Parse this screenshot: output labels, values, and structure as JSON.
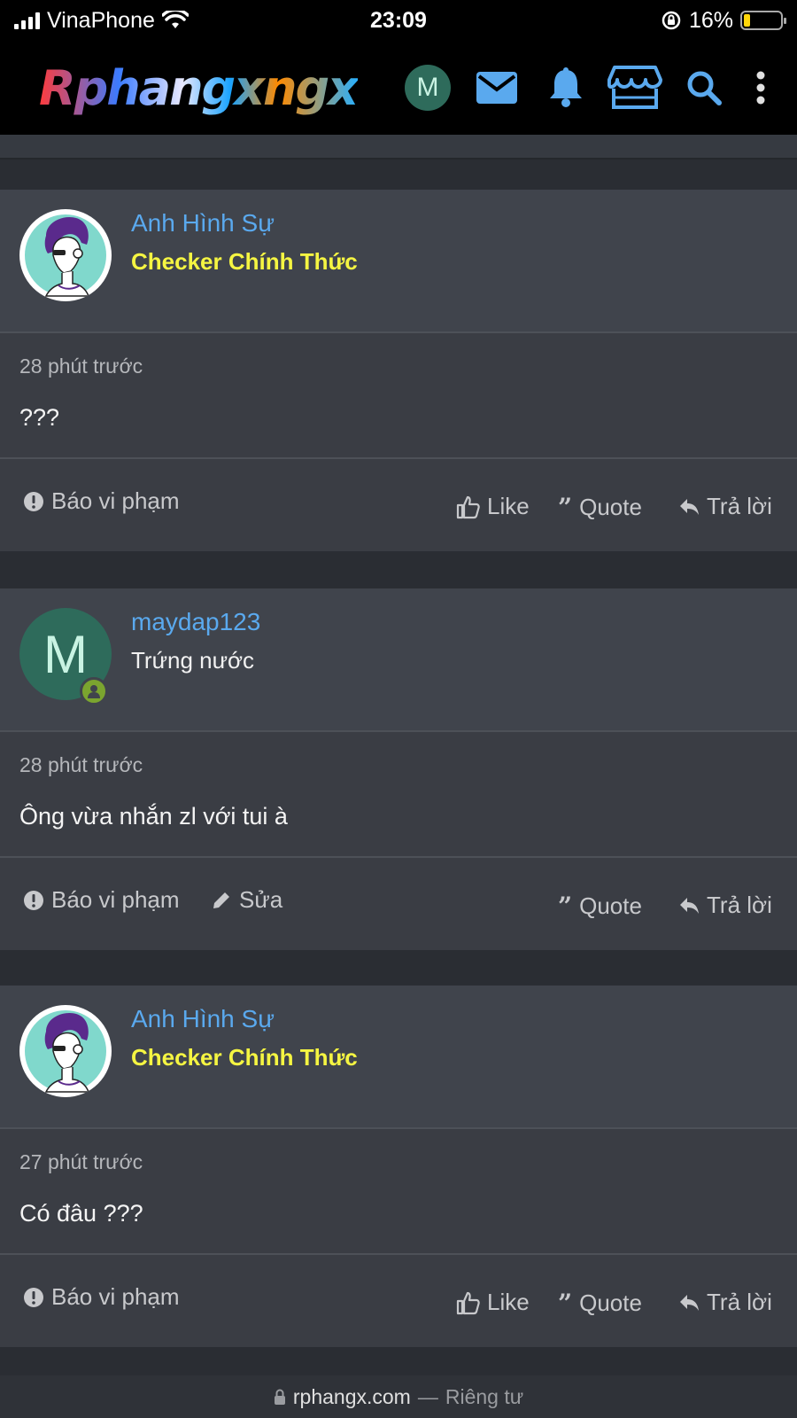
{
  "status": {
    "carrier": "VinaPhone",
    "time": "23:09",
    "battery": "16%",
    "battery_level": 0.16
  },
  "header": {
    "logo_text": "Rphangxngx",
    "avatar_letter": "M",
    "icons": [
      "mail-icon",
      "bell-icon",
      "store-icon",
      "search-icon",
      "more-vertical-icon"
    ],
    "accent": "#5aa9ee"
  },
  "posts": [
    {
      "username": "Anh Hình Sự",
      "role": "Checker Chính Thức",
      "time": "28 phút trước",
      "text": "???",
      "report": "Báo vi phạm",
      "like": "Like",
      "quote": "Quote",
      "reply": "Trả lời"
    },
    {
      "username": "maydap123",
      "avatar_letter": "M",
      "role": "Trứng nước",
      "time": "28 phút trước",
      "text": "Ông vừa nhắn zl với tui à",
      "report": "Báo vi phạm",
      "edit": "Sửa",
      "quote": "Quote",
      "reply": "Trả lời"
    },
    {
      "username": "Anh Hình Sự",
      "role": "Checker Chính Thức",
      "time": "27 phút trước",
      "text": "Có đâu ???",
      "report": "Báo vi phạm",
      "like": "Like",
      "quote": "Quote",
      "reply": "Trả lời"
    }
  ],
  "url_bar": {
    "domain": "rphangx.com",
    "separator": "—",
    "label": "Riêng tư"
  }
}
